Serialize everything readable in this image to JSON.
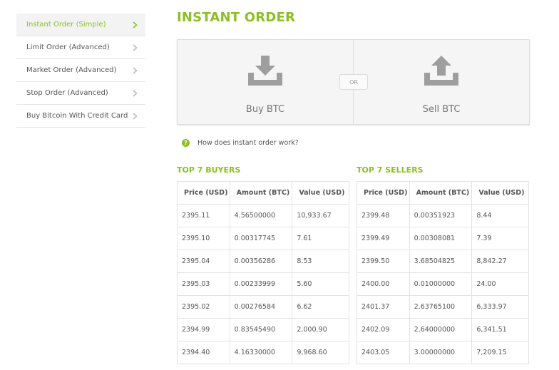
{
  "sidebar": {
    "items": [
      {
        "label": "Instant Order (Simple)",
        "active": true
      },
      {
        "label": "Limit Order (Advanced)"
      },
      {
        "label": "Market Order (Advanced)"
      },
      {
        "label": "Stop Order (Advanced)"
      },
      {
        "label": "Buy Bitcoin With Credit Card"
      }
    ]
  },
  "header": {
    "title": "INSTANT ORDER"
  },
  "trade": {
    "buy_label": "Buy BTC",
    "sell_label": "Sell BTC",
    "or_label": "OR",
    "icons": {
      "buy": "download-icon",
      "sell": "upload-icon"
    }
  },
  "help": {
    "label": "How does instant order work?",
    "icon": "?"
  },
  "buyers": {
    "title": "TOP 7 BUYERS",
    "columns": [
      "Price (USD)",
      "Amount (BTC)",
      "Value (USD)"
    ],
    "rows": [
      [
        "2395.11",
        "4.56500000",
        "10,933.67"
      ],
      [
        "2395.10",
        "0.00317745",
        "7.61"
      ],
      [
        "2395.04",
        "0.00356286",
        "8.53"
      ],
      [
        "2395.03",
        "0.00233999",
        "5.60"
      ],
      [
        "2395.02",
        "0.00276584",
        "6.62"
      ],
      [
        "2394.99",
        "0.83545490",
        "2,000.90"
      ],
      [
        "2394.40",
        "4.16330000",
        "9,968.60"
      ]
    ]
  },
  "sellers": {
    "title": "TOP 7 SELLERS",
    "columns": [
      "Price (USD)",
      "Amount (BTC)",
      "Value (USD)"
    ],
    "rows": [
      [
        "2399.48",
        "0.00351923",
        "8.44"
      ],
      [
        "2399.49",
        "0.00308081",
        "7.39"
      ],
      [
        "2399.50",
        "3.68504825",
        "8,842.27"
      ],
      [
        "2400.00",
        "0.01000000",
        "24.00"
      ],
      [
        "2401.37",
        "2.63765100",
        "6,333.97"
      ],
      [
        "2402.09",
        "2.64000000",
        "6,341.51"
      ],
      [
        "2403.05",
        "3.00000000",
        "7,209.15"
      ]
    ]
  },
  "colors": {
    "accent": "#8bbf22",
    "icon": "#9e9e9e"
  }
}
